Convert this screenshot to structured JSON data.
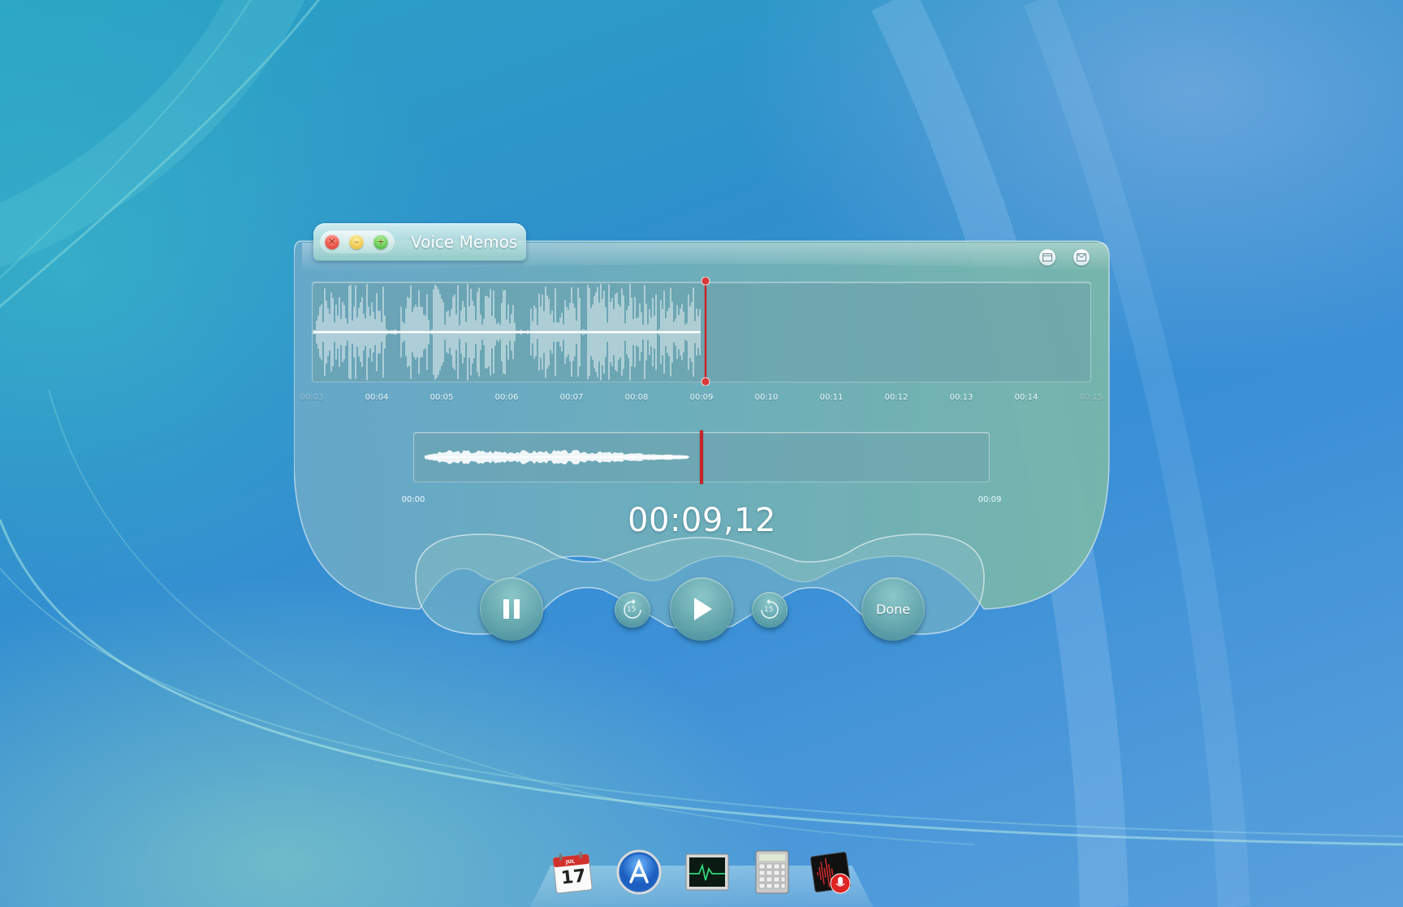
{
  "window": {
    "title": "Voice Memos",
    "traffic_lights": [
      "close-icon",
      "minimize-icon",
      "zoom-icon"
    ],
    "top_icons": [
      "window-icon",
      "share-mail-icon"
    ]
  },
  "waveform": {
    "ticks": [
      {
        "label": "00:03",
        "dim": true
      },
      {
        "label": "00:04"
      },
      {
        "label": "00:05"
      },
      {
        "label": "00:06"
      },
      {
        "label": "00:07"
      },
      {
        "label": "00:08"
      },
      {
        "label": "00:09"
      },
      {
        "label": "00:10"
      },
      {
        "label": "00:11"
      },
      {
        "label": "00:12"
      },
      {
        "label": "00:13"
      },
      {
        "label": "00:14"
      },
      {
        "label": "00:15",
        "dim": true
      }
    ],
    "playhead_time": "00:09"
  },
  "overview": {
    "start_label": "00:00",
    "end_label": "00:09"
  },
  "timer": "00:09,12",
  "controls": {
    "pause_icon": "pause-icon",
    "skip_back_label": "15",
    "play_icon": "play-icon",
    "skip_forward_label": "15",
    "done_label": "Done"
  },
  "dock": {
    "calendar_day": "17",
    "calendar_month": "JUL",
    "apps": [
      "calendar-icon",
      "app-store-icon",
      "activity-monitor-icon",
      "calculator-icon",
      "voice-memos-icon"
    ]
  },
  "colors": {
    "playhead": "#c8232a",
    "accent_teal": "#5fa9b0",
    "text_white": "#ffffff"
  }
}
